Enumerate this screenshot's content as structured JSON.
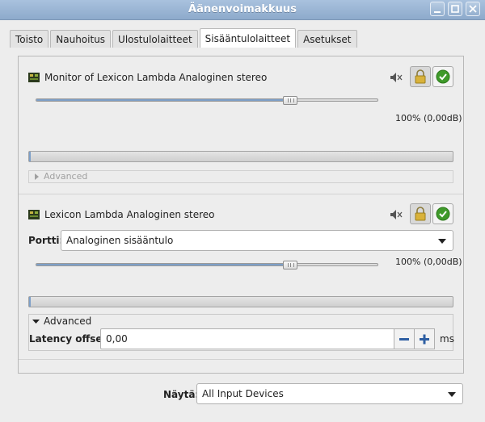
{
  "window": {
    "title": "Äänenvoimakkuus"
  },
  "tabs": [
    {
      "label": "Toisto"
    },
    {
      "label": "Nauhoitus"
    },
    {
      "label": "Ulostulolaitteet"
    },
    {
      "label": "Sisääntulolaitteet",
      "active": true
    },
    {
      "label": "Asetukset"
    }
  ],
  "devices": [
    {
      "name": "Monitor of Lexicon Lambda Analoginen stereo",
      "volume_label": "100% (0,00dB)",
      "volume_fraction": 0.74,
      "advanced_label": "Advanced",
      "advanced_expanded": false
    },
    {
      "name": "Lexicon Lambda Analoginen stereo",
      "port_label": "Portti:",
      "port_value": "Analoginen sisääntulo",
      "volume_label": "100% (0,00dB)",
      "volume_fraction": 0.74,
      "advanced_label": "Advanced",
      "advanced_expanded": true,
      "latency_label": "Latency offset:",
      "latency_value": "0,00",
      "latency_unit": "ms"
    }
  ],
  "footer": {
    "show_label": "Näytä:",
    "show_value": "All Input Devices"
  },
  "colors": {
    "titlebar": "#9bb6d5",
    "slider_fill": "#7d9fc8",
    "lock_yellow": "#d9b23a",
    "ok_green": "#3f9a2a"
  }
}
